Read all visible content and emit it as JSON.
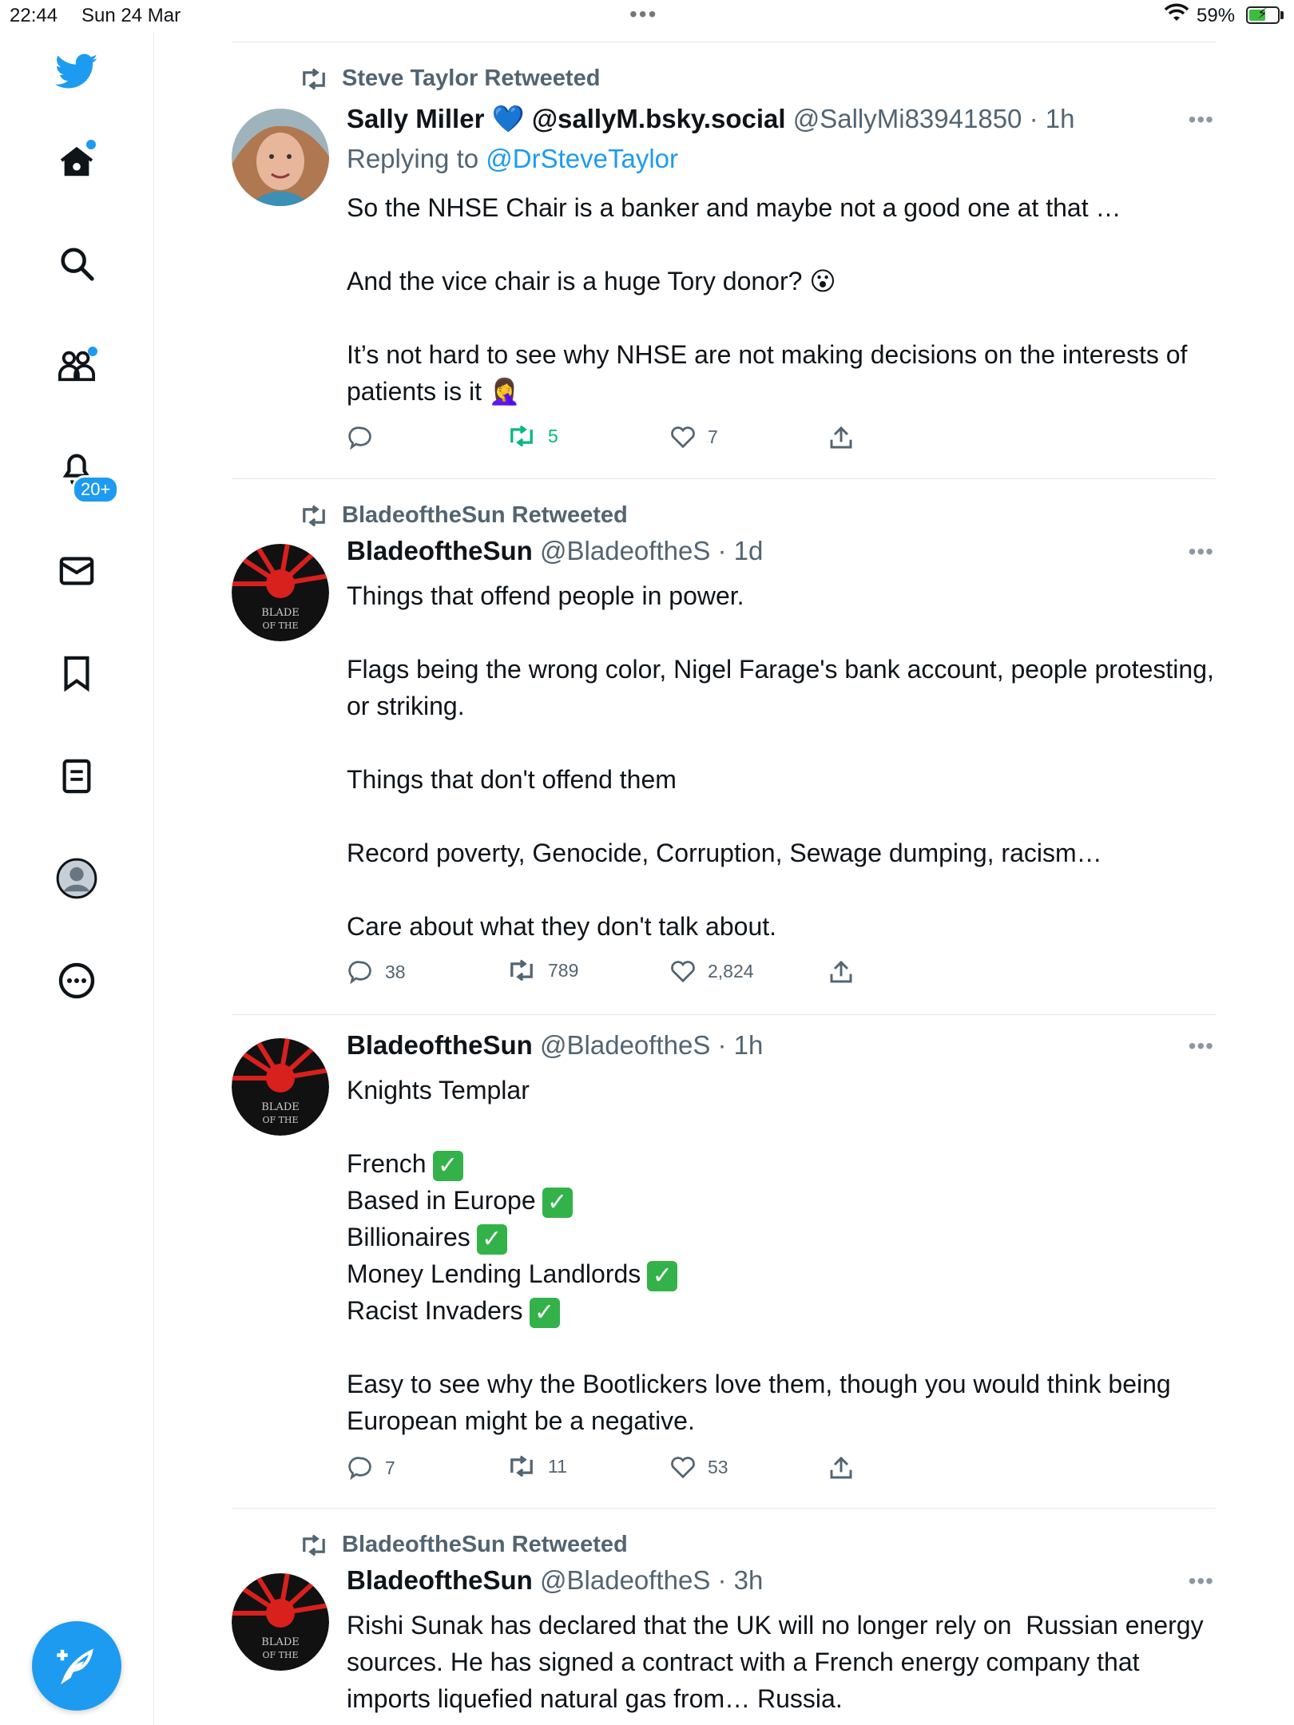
{
  "status_bar": {
    "time": "22:44",
    "date": "Sun 24 Mar",
    "battery_pct": "59%",
    "battery_level": 0.59
  },
  "sidebar": {
    "items": [
      {
        "name": "twitter-logo"
      },
      {
        "name": "home"
      },
      {
        "name": "search"
      },
      {
        "name": "communities"
      },
      {
        "name": "notifications",
        "badge": "20+"
      },
      {
        "name": "messages"
      },
      {
        "name": "bookmarks"
      },
      {
        "name": "lists"
      },
      {
        "name": "profile"
      },
      {
        "name": "more"
      }
    ],
    "notifications_badge": "20+"
  },
  "tweets": [
    {
      "retweeted_by": "Steve Taylor Retweeted",
      "name": "Sally Miller 💙 @sallyM.bsky.social",
      "handle": "@SallyMi83941850 · 1h",
      "replying_label": "Replying to",
      "replying_to": "@DrSteveTaylor",
      "body": [
        "So the NHSE Chair is a banker and maybe not a good one at that …",
        "And the vice chair is a huge Tory donor? 😮",
        "It’s not hard to see why NHSE are not making decisions on the interests of patients is it 🤦‍♀️"
      ],
      "replies": "",
      "retweets": "5",
      "likes": "7"
    },
    {
      "retweeted_by": "BladeoftheSun Retweeted",
      "name": "BladeoftheSun",
      "handle": "@BladeoftheS · 1d",
      "body": [
        "Things that offend people in power.",
        "Flags being the wrong color, Nigel Farage's bank account, people protesting, or striking.",
        "Things that don't offend them",
        "Record poverty, Genocide, Corruption, Sewage dumping, racism…",
        "Care about what they don't talk about."
      ],
      "replies": "38",
      "retweets": "789",
      "likes": "2,824"
    },
    {
      "name": "BladeoftheSun",
      "handle": "@BladeoftheS · 1h",
      "body_first": "Knights Templar",
      "checklist": [
        "French",
        "Based in Europe",
        "Billionaires",
        "Money Lending Landlords",
        "Racist Invaders"
      ],
      "check_mark": "✓",
      "body_last": "Easy to see why the Bootlickers love them, though you would think being European might be a negative.",
      "replies": "7",
      "retweets": "11",
      "likes": "53"
    },
    {
      "retweeted_by": "BladeoftheSun Retweeted",
      "name": "BladeoftheSun",
      "handle": "@BladeoftheS · 3h",
      "body": [
        "Rishi Sunak has declared that the UK will no longer rely on  Russian energy sources. He has signed a contract with a French energy company that imports liquefied natural gas from… Russia."
      ]
    }
  ],
  "more_glyph": "•••",
  "colors": {
    "accent": "#1d9bf0",
    "retweet_green": "#00ba7c",
    "muted": "#536471"
  }
}
